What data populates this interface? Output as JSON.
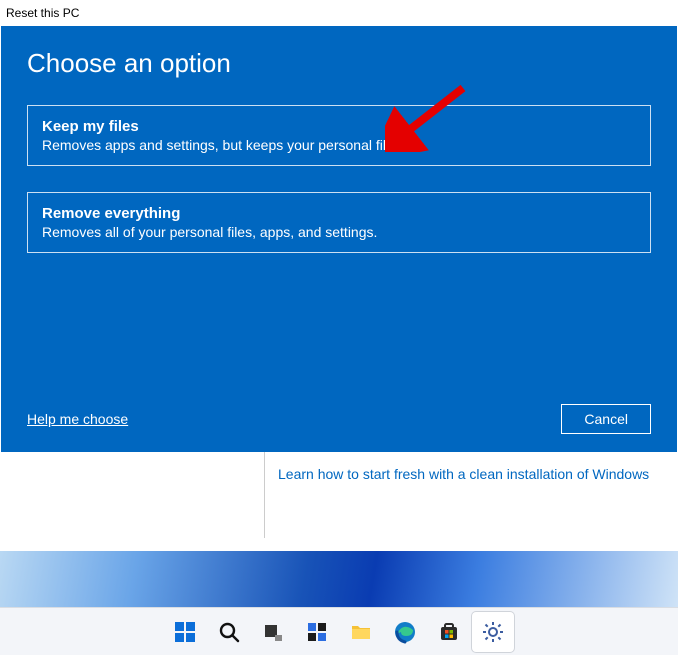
{
  "window": {
    "title": "Reset this PC"
  },
  "dialog": {
    "heading": "Choose an option",
    "options": [
      {
        "title": "Keep my files",
        "desc": "Removes apps and settings, but keeps your personal files."
      },
      {
        "title": "Remove everything",
        "desc": "Removes all of your personal files, apps, and settings."
      }
    ],
    "help": "Help me choose",
    "cancel": "Cancel"
  },
  "underlying": {
    "link": "Learn how to start fresh with a clean installation of Windows"
  }
}
